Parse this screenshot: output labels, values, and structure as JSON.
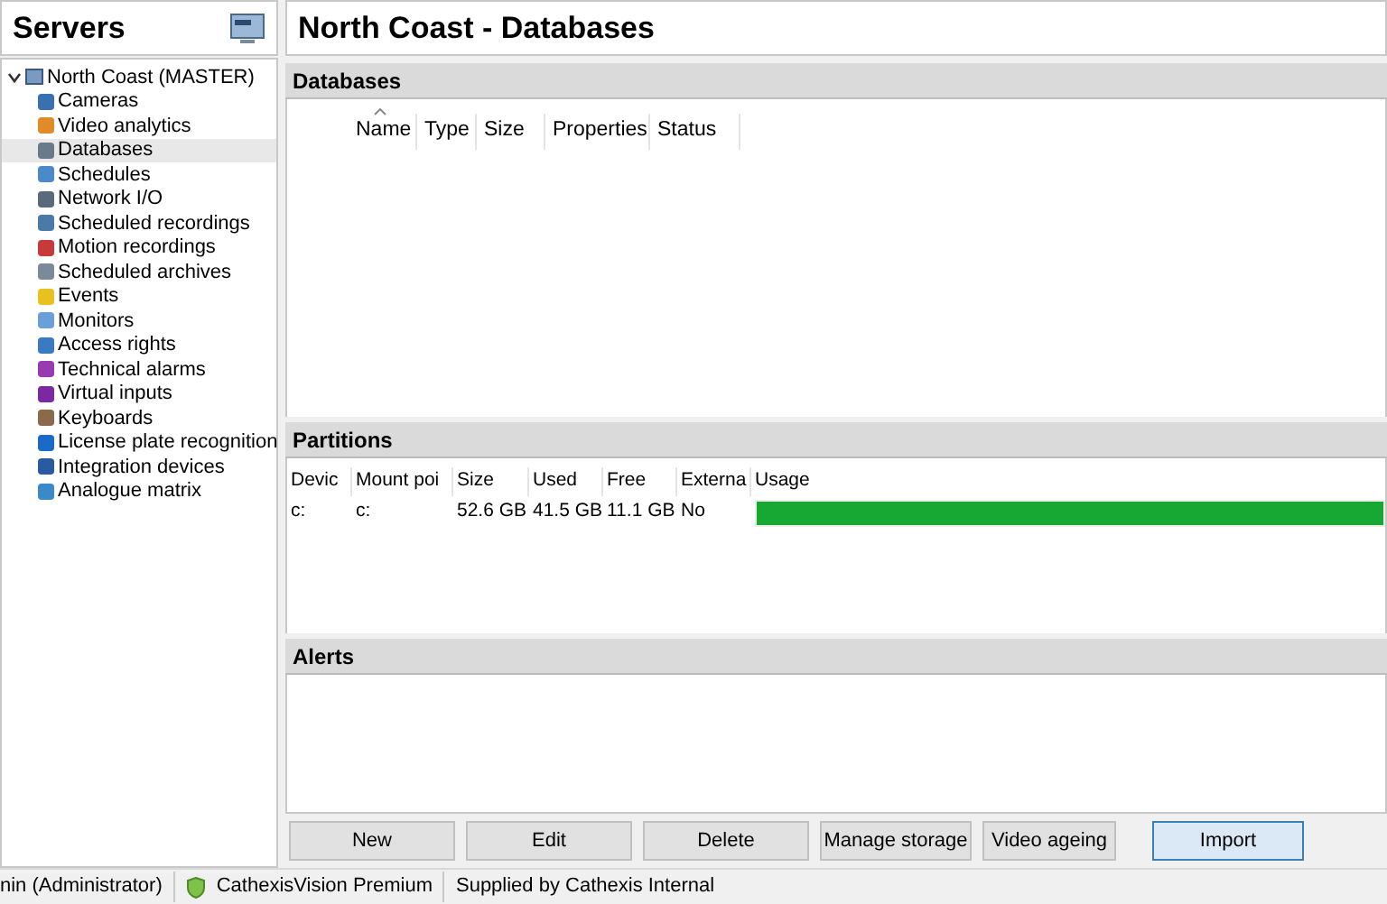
{
  "sidebar": {
    "title": "Servers",
    "tree": [
      {
        "label": "North Coast (MASTER)",
        "expanded": true,
        "selected": false,
        "children": [
          {
            "label": "Cameras",
            "selected": false
          },
          {
            "label": "Video analytics",
            "selected": false
          },
          {
            "label": "Databases",
            "selected": true
          },
          {
            "label": "Schedules",
            "selected": false
          },
          {
            "label": "Network I/O",
            "selected": false
          },
          {
            "label": "Scheduled recordings",
            "selected": false
          },
          {
            "label": "Motion recordings",
            "selected": false
          },
          {
            "label": "Scheduled archives",
            "selected": false
          },
          {
            "label": "Events",
            "selected": false
          },
          {
            "label": "Monitors",
            "selected": false
          },
          {
            "label": "Access rights",
            "selected": false
          },
          {
            "label": "Technical alarms",
            "selected": false
          },
          {
            "label": "Virtual inputs",
            "selected": false
          },
          {
            "label": "Keyboards",
            "selected": false
          },
          {
            "label": "License plate recognition",
            "selected": false
          },
          {
            "label": "Integration devices",
            "selected": false
          },
          {
            "label": "Analogue matrix",
            "selected": false
          }
        ]
      }
    ]
  },
  "title": "North Coast - Databases",
  "databases": {
    "header": "Databases",
    "columns": [
      "Name",
      "Type",
      "Size",
      "Properties",
      "Status"
    ]
  },
  "partitions": {
    "header": "Partitions",
    "columns": [
      "Devic",
      "Mount poi",
      "Size",
      "Used",
      "Free",
      "Externa",
      "Usage"
    ],
    "rows": [
      {
        "cells": [
          "c:",
          "c:",
          "52.6 GB",
          "41.5 GB",
          "11.1 GB",
          "No"
        ],
        "level": 1
      }
    ]
  },
  "alerts": {
    "header": "Alerts"
  },
  "buttons": [
    {
      "label": "New",
      "focused": false
    },
    {
      "label": "Edit",
      "focused": false
    },
    {
      "label": "Delete",
      "focused": false
    },
    {
      "label": "Manage storage",
      "focused": false
    },
    {
      "label": "Video ageing",
      "focused": false
    },
    {
      "label": "Import",
      "focused": true
    }
  ],
  "status_bar": {
    "user": "nin (Administrator)",
    "product": "CathexisVision Premium",
    "supplier": "Supplied by Cathexis Internal"
  }
}
